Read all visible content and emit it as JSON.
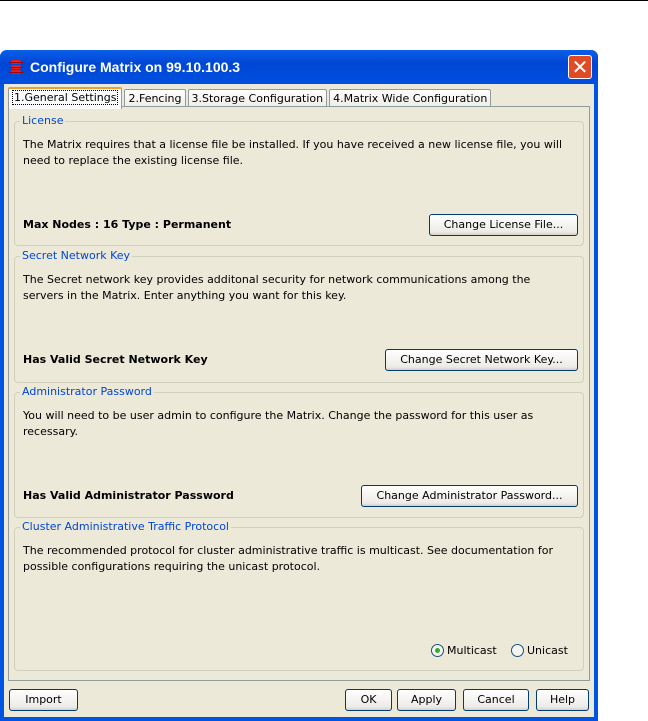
{
  "window": {
    "title": "Configure Matrix on 99.10.100.3"
  },
  "tabs": [
    "1.General Settings",
    "2.Fencing",
    "3.Storage Configuration",
    "4.Matrix Wide Configuration"
  ],
  "license": {
    "legend": "License",
    "desc": "The Matrix requires that a license file be installed. If you have received a new license file, you will need to replace the existing license file.",
    "status": "Max Nodes : 16  Type : Permanent",
    "button": "Change License File..."
  },
  "secret": {
    "legend": "Secret Network Key",
    "desc": "The Secret network key provides additonal security for network communications among the servers in the Matrix. Enter anything you want for this key.",
    "status": "Has Valid Secret Network Key",
    "button": "Change Secret Network Key..."
  },
  "admin": {
    "legend": "Administrator Password",
    "desc": "You will need to be user admin to configure the Matrix. Change the password for this user as recessary.",
    "status": "Has Valid Administrator Password",
    "button": "Change Administrator Password..."
  },
  "protocol": {
    "legend": "Cluster Administrative Traffic Protocol",
    "desc": "The recommended protocol for cluster administrative traffic is multicast. See documentation for possible configurations requiring the unicast protocol.",
    "options": [
      "Multicast",
      "Unicast"
    ],
    "selected": "Multicast"
  },
  "footer": {
    "import": "Import",
    "ok": "OK",
    "apply": "Apply",
    "cancel": "Cancel",
    "help": "Help"
  }
}
